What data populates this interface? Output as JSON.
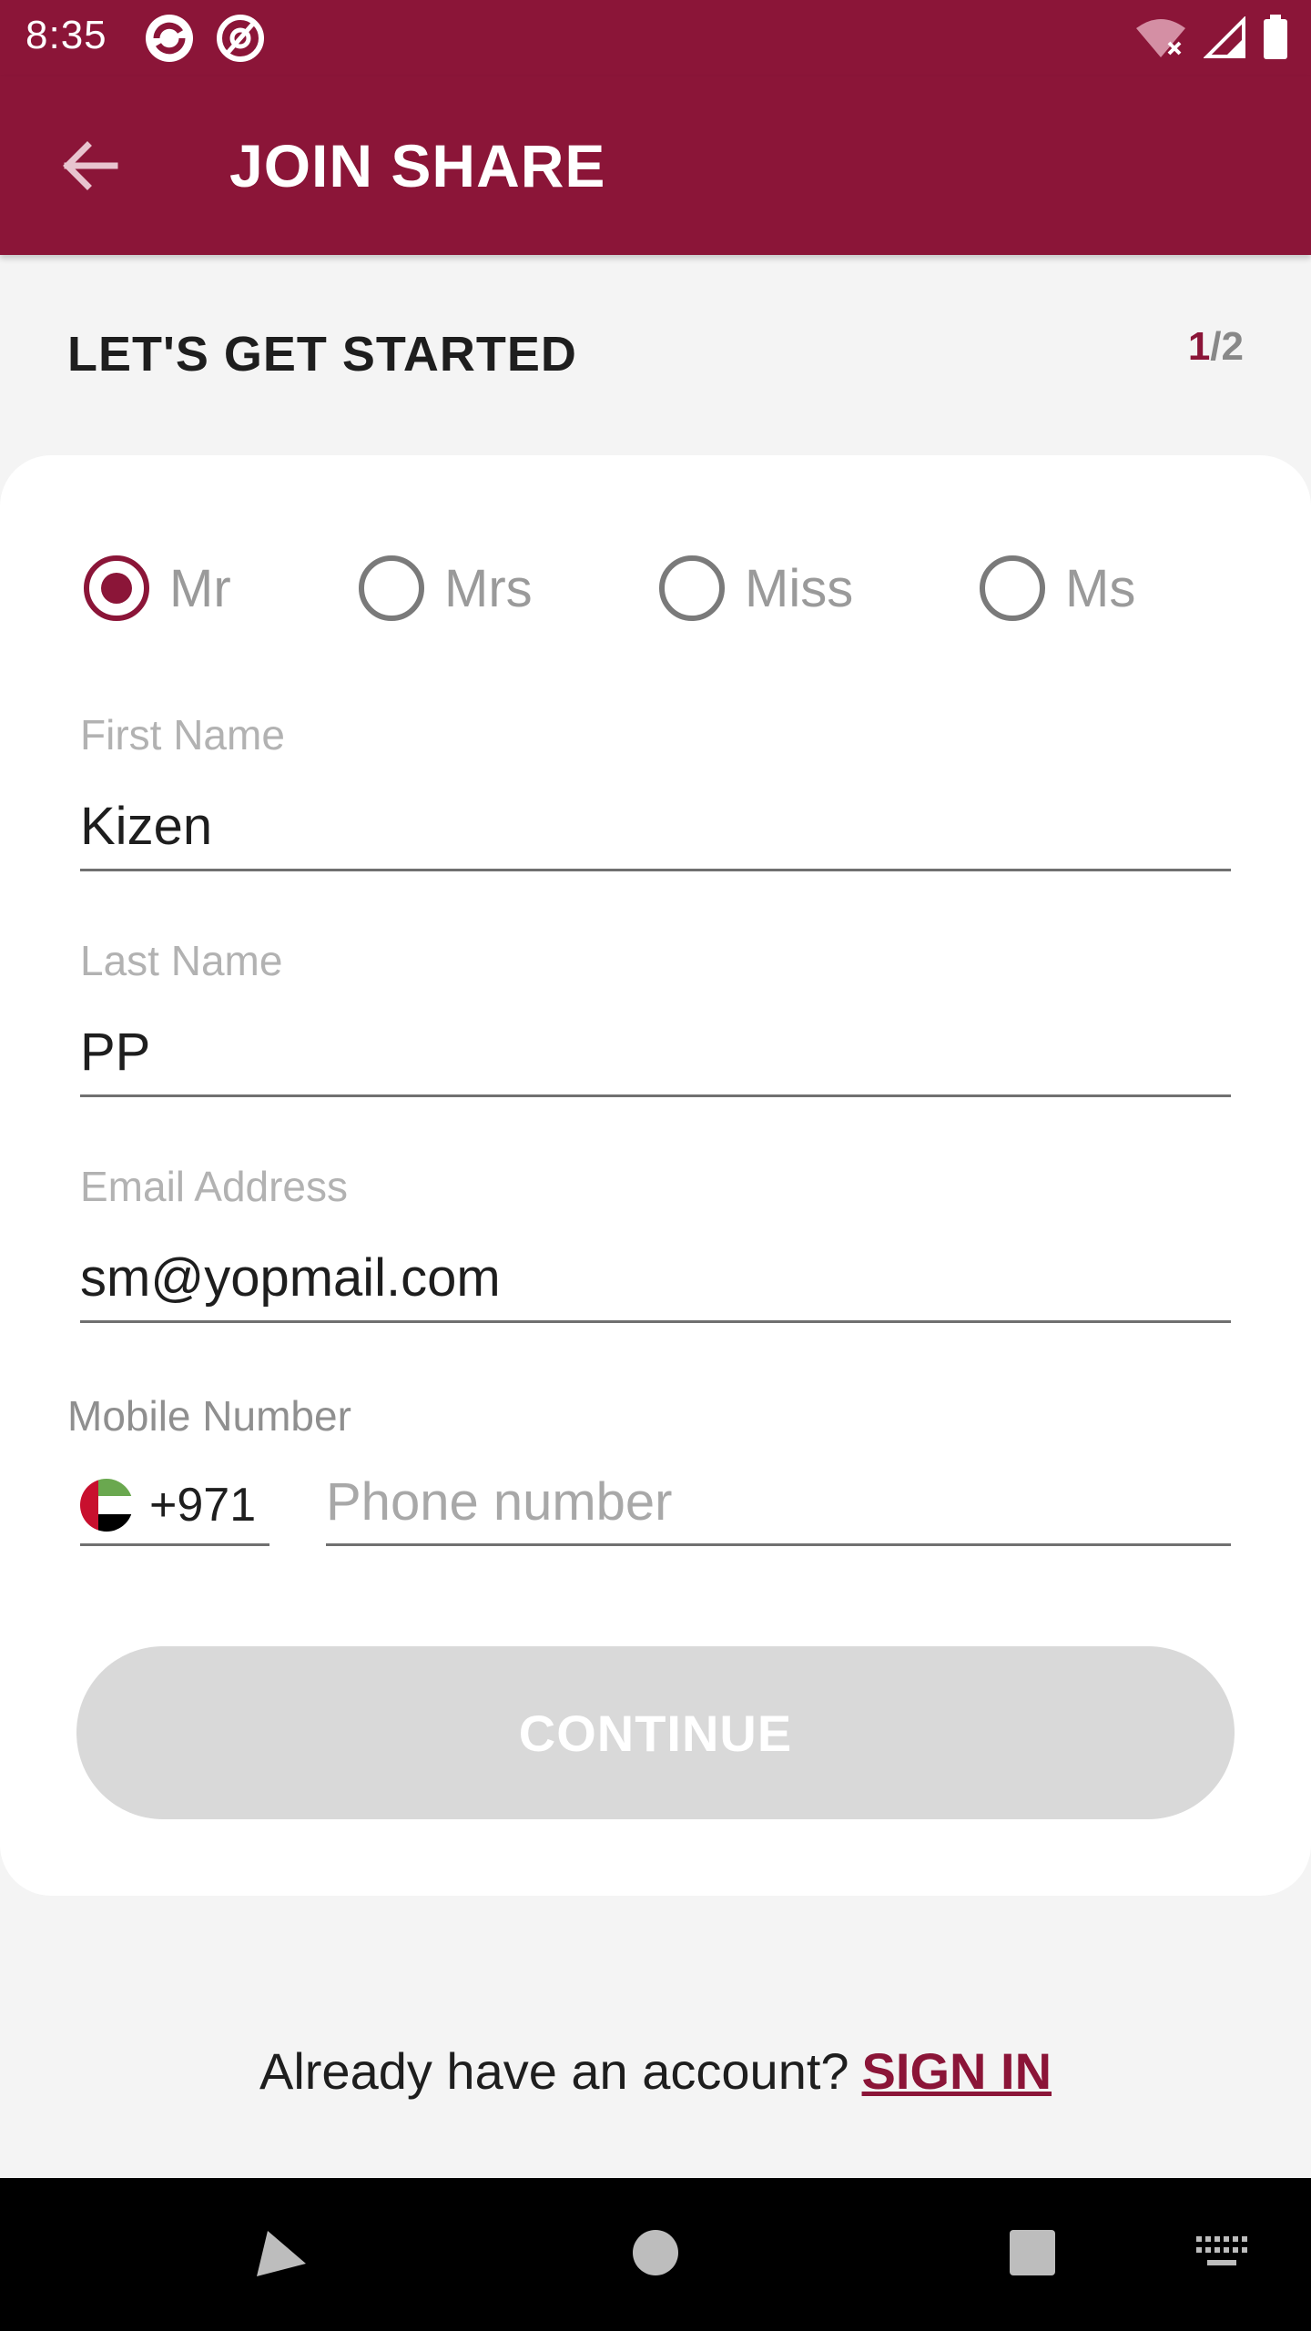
{
  "status_bar": {
    "time": "8:35",
    "icons": [
      "app-logo-icon",
      "at-sign-icon",
      "wifi-off-icon",
      "signal-icon",
      "battery-icon"
    ]
  },
  "app_bar": {
    "back_icon": "arrow-left-icon",
    "title": "JOIN SHARE",
    "background_color": "#8b1538"
  },
  "header": {
    "title": "LET'S GET STARTED",
    "step_current": "1",
    "step_total": "/2"
  },
  "form": {
    "titles": [
      {
        "label": "Mr",
        "selected": true
      },
      {
        "label": "Mrs",
        "selected": false
      },
      {
        "label": "Miss",
        "selected": false
      },
      {
        "label": "Ms",
        "selected": false
      }
    ],
    "first_name": {
      "label": "First Name",
      "value": "Kizen"
    },
    "last_name": {
      "label": "Last Name",
      "value": "PP"
    },
    "email": {
      "label": "Email Address",
      "value": "sm@yopmail.com"
    },
    "mobile": {
      "label": "Mobile Number",
      "country_code": "+971",
      "country_flag_icon": "uae-flag-icon",
      "placeholder": "Phone number",
      "value": ""
    },
    "continue_label": "CONTINUE"
  },
  "footer": {
    "prompt": "Already have an account?",
    "link": "SIGN IN"
  },
  "nav_bar": {
    "icons": [
      "back-triangle-icon",
      "home-circle-icon",
      "recents-square-icon",
      "keyboard-icon"
    ]
  },
  "colors": {
    "accent": "#8b1538",
    "disabled_button": "#d9d9d9",
    "page_background": "#f4f4f4"
  }
}
